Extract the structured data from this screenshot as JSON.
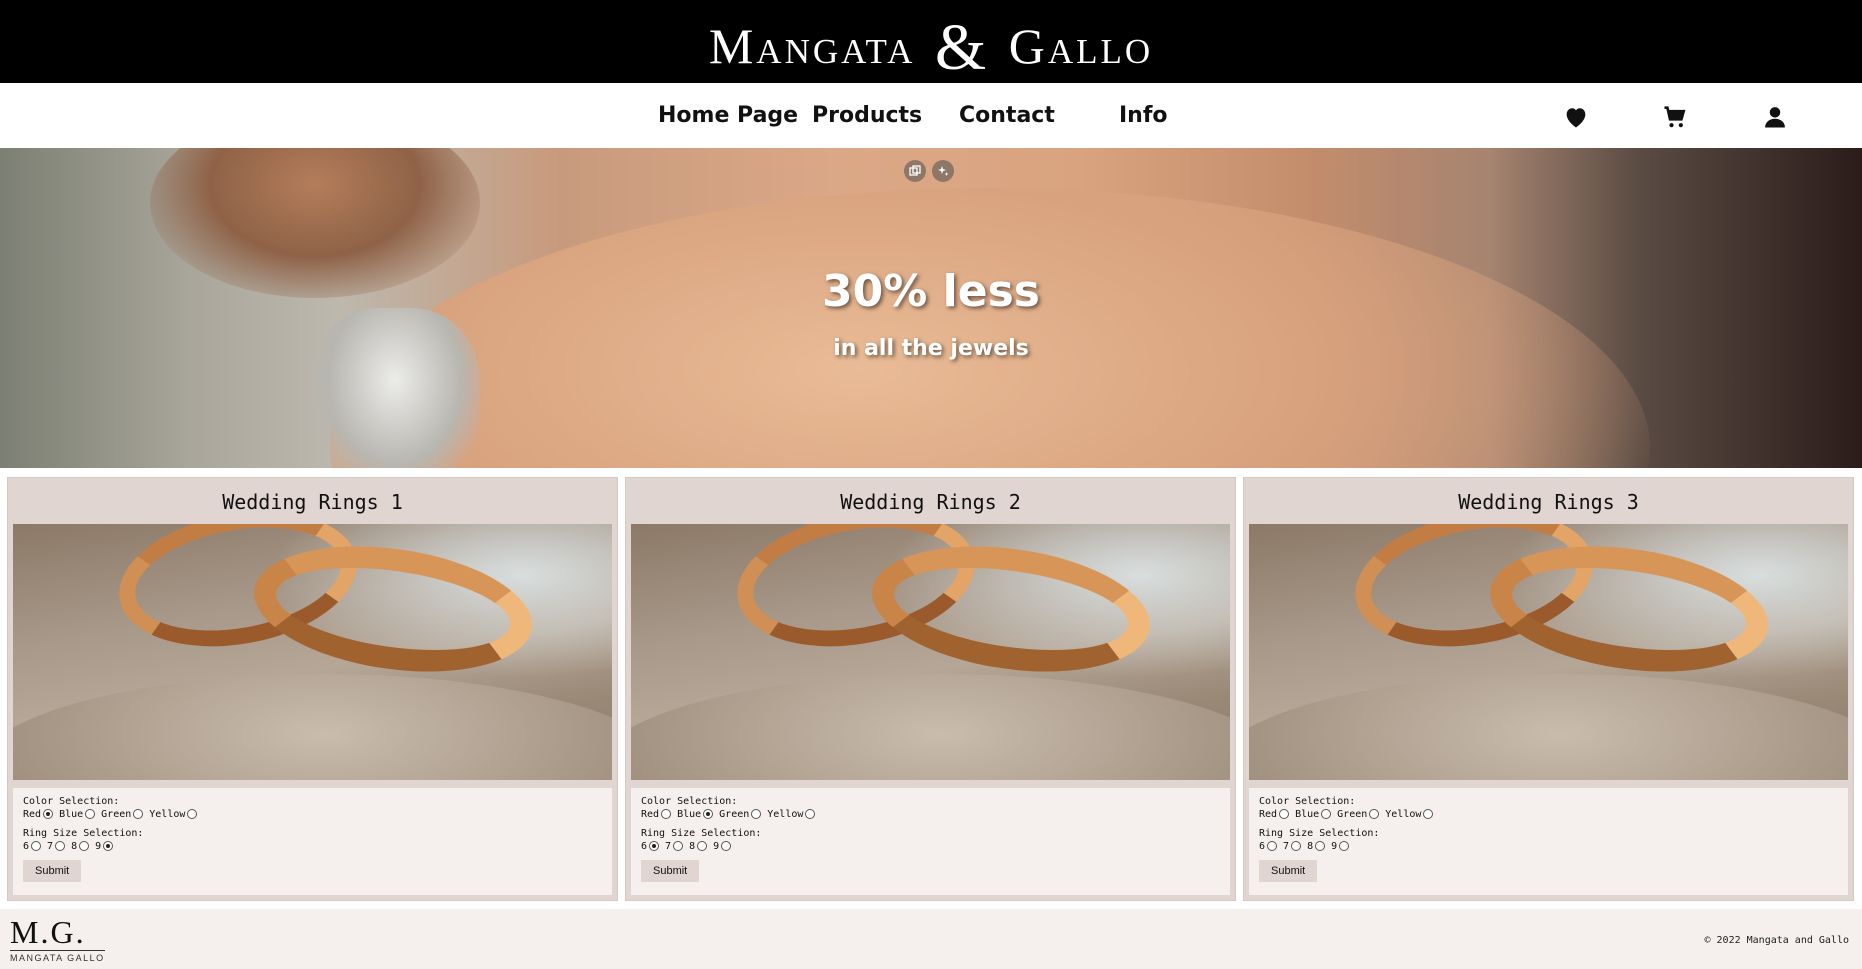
{
  "header": {
    "brand_left": "Mangata",
    "brand_amp": "&",
    "brand_right": "Gallo"
  },
  "nav": {
    "links": [
      "Home Page",
      "Products",
      "Contact",
      "Info"
    ],
    "icons": [
      "heart-icon",
      "cart-icon",
      "user-icon"
    ]
  },
  "hero": {
    "title": "30% less",
    "subtitle": "in all the jewels"
  },
  "products": [
    {
      "title": "Wedding Rings 1",
      "color_label": "Color Selection:",
      "colors": [
        "Red",
        "Blue",
        "Green",
        "Yellow"
      ],
      "selected_color": "Red",
      "size_label": "Ring Size Selection:",
      "sizes": [
        "6",
        "7",
        "8",
        "9"
      ],
      "selected_size": "9",
      "submit_label": "Submit"
    },
    {
      "title": "Wedding Rings 2",
      "color_label": "Color Selection:",
      "colors": [
        "Red",
        "Blue",
        "Green",
        "Yellow"
      ],
      "selected_color": "Blue",
      "size_label": "Ring Size Selection:",
      "sizes": [
        "6",
        "7",
        "8",
        "9"
      ],
      "selected_size": "6",
      "submit_label": "Submit"
    },
    {
      "title": "Wedding Rings 3",
      "color_label": "Color Selection:",
      "colors": [
        "Red",
        "Blue",
        "Green",
        "Yellow"
      ],
      "selected_color": "",
      "size_label": "Ring Size Selection:",
      "sizes": [
        "6",
        "7",
        "8",
        "9"
      ],
      "selected_size": "",
      "submit_label": "Submit"
    }
  ],
  "footer": {
    "logo_mark": "M.G.",
    "logo_word": "MANGATA GALLO",
    "copyright": "© 2022 Mangata and Gallo"
  },
  "colors": {
    "header_bg": "#000000",
    "card_bg": "#e0d5d0",
    "form_bg": "#f5f0ed"
  }
}
